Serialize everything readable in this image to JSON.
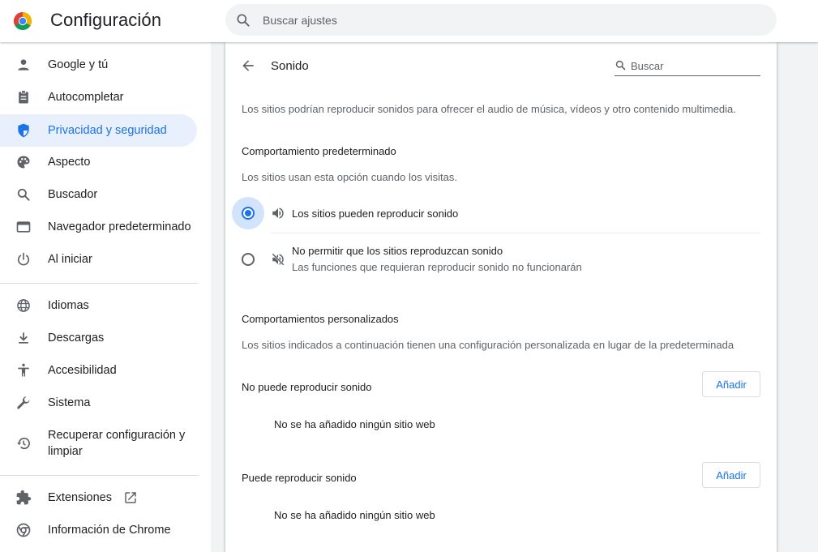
{
  "header": {
    "title": "Configuración",
    "search_placeholder": "Buscar ajustes"
  },
  "sidebar": {
    "items": [
      {
        "label": "Google y tú",
        "icon": "person-icon"
      },
      {
        "label": "Autocompletar",
        "icon": "clipboard-icon"
      },
      {
        "label": "Privacidad y seguridad",
        "icon": "shield-icon",
        "active": true
      },
      {
        "label": "Aspecto",
        "icon": "palette-icon"
      },
      {
        "label": "Buscador",
        "icon": "search-icon"
      },
      {
        "label": "Navegador predeterminado",
        "icon": "browser-window-icon"
      },
      {
        "label": "Al iniciar",
        "icon": "power-icon"
      },
      {
        "label": "Idiomas",
        "icon": "globe-icon"
      },
      {
        "label": "Descargas",
        "icon": "download-icon"
      },
      {
        "label": "Accesibilidad",
        "icon": "accessibility-icon"
      },
      {
        "label": "Sistema",
        "icon": "wrench-icon"
      },
      {
        "label": "Recuperar configuración y limpiar",
        "icon": "restore-icon"
      },
      {
        "label": "Extensiones",
        "icon": "puzzle-icon"
      },
      {
        "label": "Información de Chrome",
        "icon": "chrome-icon"
      }
    ]
  },
  "page": {
    "title": "Sonido",
    "search_placeholder": "Buscar",
    "description": "Los sitios podrían reproducir sonidos para ofrecer el audio de música, vídeos y otro contenido multimedia.",
    "default_behavior": {
      "heading": "Comportamiento predeterminado",
      "subtitle": "Los sitios usan esta opción cuando los visitas.",
      "options": [
        {
          "label": "Los sitios pueden reproducir sonido",
          "sublabel": "",
          "checked": true,
          "icon": "volume-up-icon"
        },
        {
          "label": "No permitir que los sitios reproduzcan sonido",
          "sublabel": "Las funciones que requieran reproducir sonido no funcionarán",
          "checked": false,
          "icon": "volume-off-icon"
        }
      ]
    },
    "custom_behavior": {
      "heading": "Comportamientos personalizados",
      "subtitle": "Los sitios indicados a continuación tienen una configuración personalizada en lugar de la predeterminada",
      "lists": [
        {
          "title": "No puede reproducir sonido",
          "add_label": "Añadir",
          "empty_text": "No se ha añadido ningún sitio web"
        },
        {
          "title": "Puede reproducir sonido",
          "add_label": "Añadir",
          "empty_text": "No se ha añadido ningún sitio web"
        }
      ]
    }
  },
  "colors": {
    "accent": "#1a73e8",
    "active_bg": "#e8f0fe",
    "text_primary": "#202124",
    "text_secondary": "#5f6368"
  }
}
